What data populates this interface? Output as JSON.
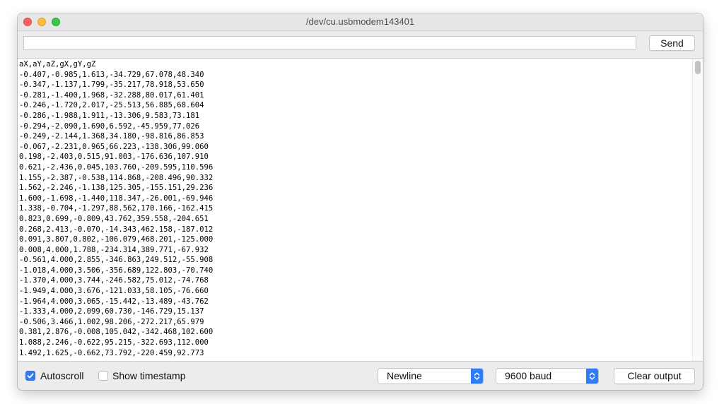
{
  "window": {
    "title": "/dev/cu.usbmodem143401"
  },
  "input": {
    "value": "",
    "send_label": "Send"
  },
  "output": {
    "lines": [
      "aX,aY,aZ,gX,gY,gZ",
      "-0.407,-0.985,1.613,-34.729,67.078,48.340",
      "-0.347,-1.137,1.799,-35.217,78.918,53.650",
      "-0.281,-1.400,1.968,-32.288,80.017,61.401",
      "-0.246,-1.720,2.017,-25.513,56.885,68.604",
      "-0.286,-1.988,1.911,-13.306,9.583,73.181",
      "-0.294,-2.090,1.690,6.592,-45.959,77.026",
      "-0.249,-2.144,1.368,34.180,-98.816,86.853",
      "-0.067,-2.231,0.965,66.223,-138.306,99.060",
      "0.198,-2.403,0.515,91.003,-176.636,107.910",
      "0.621,-2.436,0.045,103.760,-209.595,110.596",
      "1.155,-2.387,-0.538,114.868,-208.496,90.332",
      "1.562,-2.246,-1.138,125.305,-155.151,29.236",
      "1.600,-1.698,-1.440,118.347,-26.001,-69.946",
      "1.338,-0.704,-1.297,88.562,170.166,-162.415",
      "0.823,0.699,-0.809,43.762,359.558,-204.651",
      "0.268,2.413,-0.070,-14.343,462.158,-187.012",
      "0.091,3.807,0.802,-106.079,468.201,-125.000",
      "0.008,4.000,1.788,-234.314,389.771,-67.932",
      "-0.561,4.000,2.855,-346.863,249.512,-55.908",
      "-1.018,4.000,3.506,-356.689,122.803,-70.740",
      "-1.370,4.000,3.744,-246.582,75.012,-74.768",
      "-1.949,4.000,3.676,-121.033,58.105,-76.660",
      "-1.964,4.000,3.065,-15.442,-13.489,-43.762",
      "-1.333,4.000,2.099,60.730,-146.729,15.137",
      "-0.506,3.466,1.002,98.206,-272.217,65.979",
      "0.381,2.876,-0.008,105.042,-342.468,102.600",
      "1.088,2.246,-0.622,95.215,-322.693,112.000",
      "1.492,1.625,-0.662,73.792,-220.459,92.773"
    ]
  },
  "bottom": {
    "autoscroll_label": "Autoscroll",
    "autoscroll_checked": true,
    "timestamp_label": "Show timestamp",
    "timestamp_checked": false,
    "line_ending": "Newline",
    "baud": "9600 baud",
    "clear_label": "Clear output"
  },
  "colors": {
    "accent": "#2f7cf6",
    "close": "#fc605c",
    "minimize": "#fdbc40",
    "zoom": "#34c84a"
  }
}
